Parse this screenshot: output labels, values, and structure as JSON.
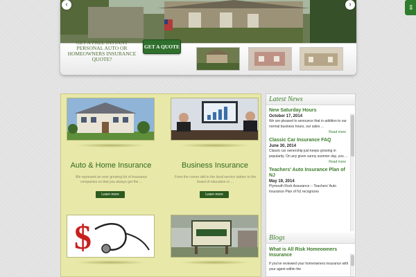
{
  "hero": {
    "quote_text": "GET A FREE INSTANT PERSONAL AUTO OR HOMEOWNERS INSURANCE QUOTE?",
    "quote_button": "GET A QUOTE",
    "prev_arrow": "‹",
    "next_arrow": "›",
    "side_tab": "co"
  },
  "services": [
    {
      "title": "Auto & Home Insurance",
      "desc": "We represent an ever growing list of insurance companies so that you always get the ...",
      "button": "Learn more"
    },
    {
      "title": "Business Insurance",
      "desc": "From the corner deli in the local service station to the board of education or ...",
      "button": "Learn more"
    }
  ],
  "news": {
    "heading": "Latest News",
    "items": [
      {
        "title": "New Saturday Hours",
        "date": "October 17, 2014",
        "body": "We are pleased to announce that in addition to our normal business hours, our sales ...",
        "read_more": "Read more"
      },
      {
        "title": "Classic Car Insurance FAQ",
        "date": "June 30, 2014",
        "body": "Classic car ownership just keeps growing in popularity.  On any given sunny summer day, you ...",
        "read_more": "Read more"
      },
      {
        "title": "Teachers' Auto Insurance Plan of NJ",
        "date": "May 19, 2014",
        "body": "Plymouth Rock Assurance -- Teachers' Auto Insurance Plan of NJ recognizes",
        "read_more": ""
      }
    ]
  },
  "blogs": {
    "heading": "Blogs",
    "items": [
      {
        "title": "What is All Risk Homeowners Insurance",
        "body": "If you've reviewed your homeowners insurance with your agent within the"
      }
    ]
  },
  "colors": {
    "accent_green": "#2f6f2c",
    "panel_yellow": "#e8e8a8",
    "link_green": "#3c7c2a"
  }
}
